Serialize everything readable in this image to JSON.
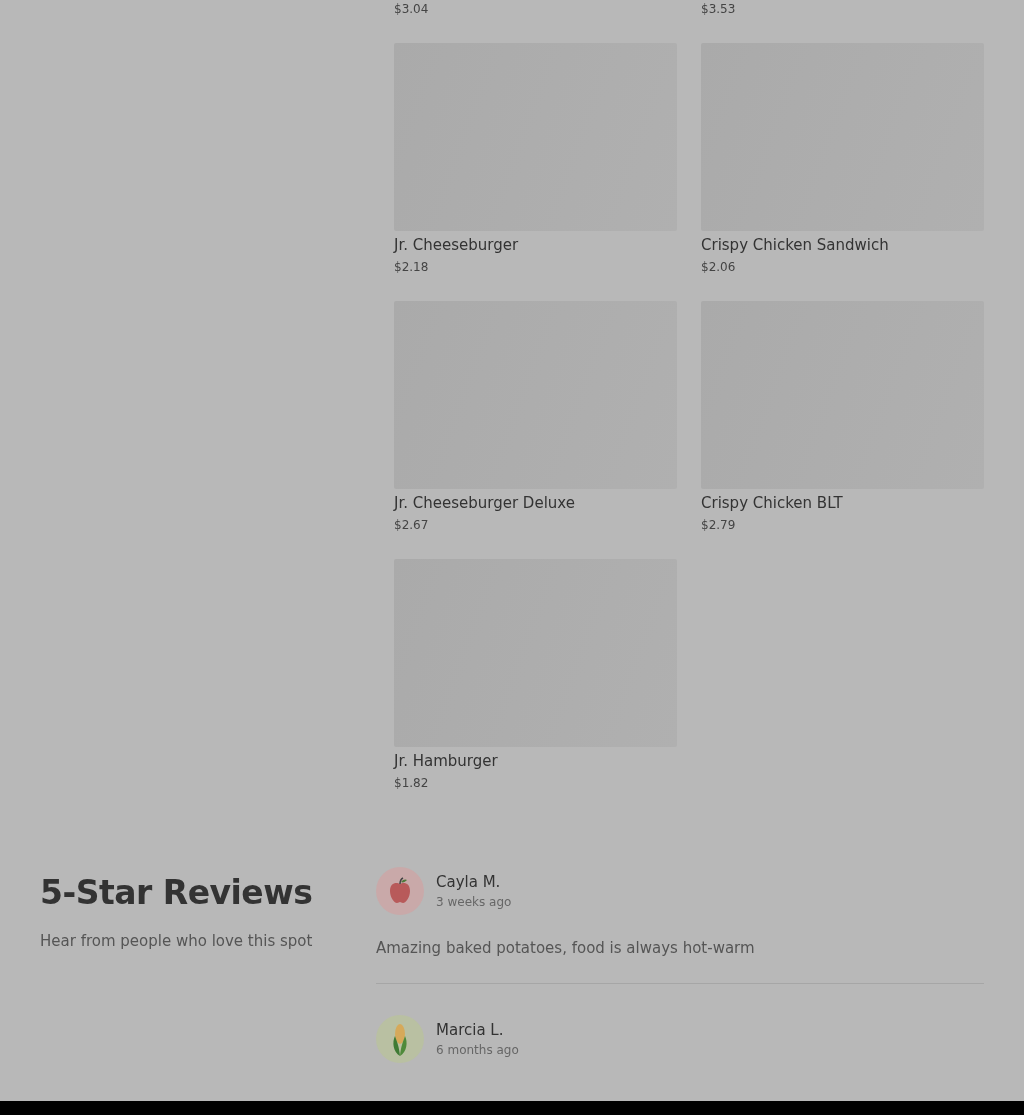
{
  "menu_items": [
    {
      "price": "$3.04"
    },
    {
      "price": "$3.53"
    },
    {
      "name": "Jr. Cheeseburger",
      "price": "$2.18"
    },
    {
      "name": "Crispy Chicken Sandwich",
      "price": "$2.06"
    },
    {
      "name": "Jr. Cheeseburger Deluxe",
      "price": "$2.67"
    },
    {
      "name": "Crispy Chicken BLT",
      "price": "$2.79"
    },
    {
      "name": "Jr. Hamburger",
      "price": "$1.82"
    }
  ],
  "reviews_section": {
    "title": "5-Star Reviews",
    "subtitle": "Hear from people who love this spot",
    "reviews": [
      {
        "name": "Cayla M.",
        "time": "3 weeks ago",
        "kind": "apple",
        "color": "#c9a9a9",
        "text": "Amazing baked potatoes, food is always hot-warm"
      },
      {
        "name": "Marcia L.",
        "time": "6 months ago",
        "kind": "corn",
        "color": "#b9c0a2"
      }
    ]
  }
}
